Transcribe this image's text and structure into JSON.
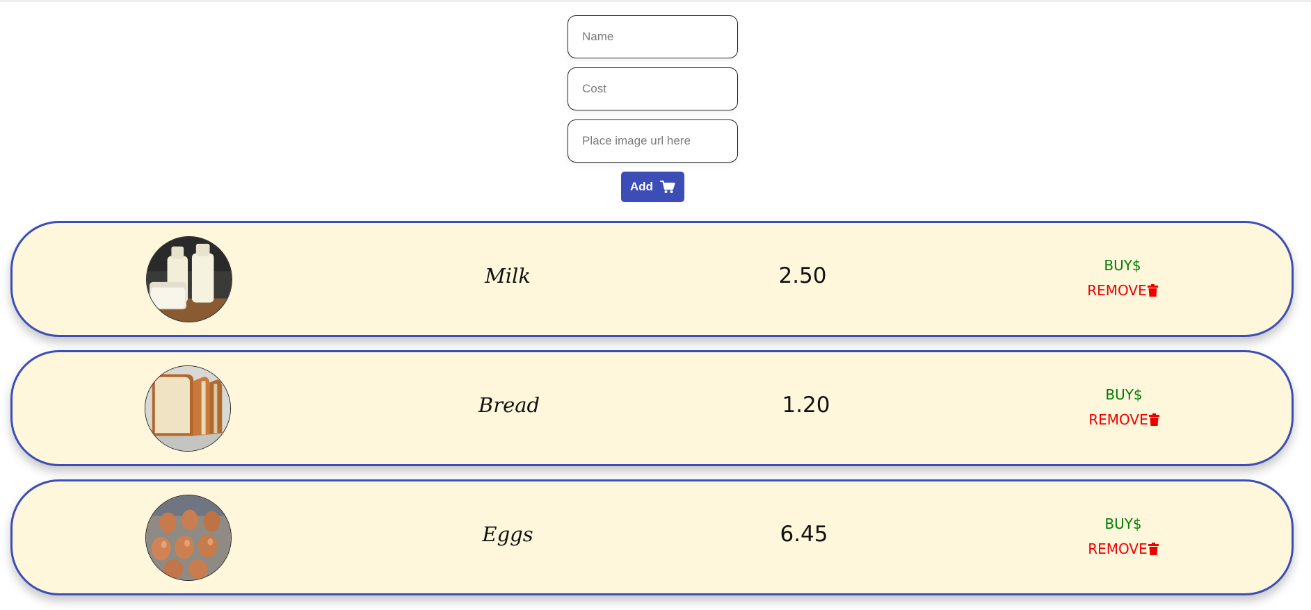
{
  "form": {
    "name_placeholder": "Name",
    "cost_placeholder": "Cost",
    "image_placeholder": "Place image url here",
    "add_label": "Add",
    "add_icon": "shopping-cart-icon"
  },
  "colors": {
    "accent": "#3d4db7",
    "card_background": "#fff7dc",
    "buy": "#007d00",
    "remove": "#ee0000"
  },
  "items": [
    {
      "name": "Milk",
      "cost": "2.50",
      "buy_label": "BUY$",
      "remove_label": "REMOVE",
      "image": "milk-photo"
    },
    {
      "name": "Bread",
      "cost": "1.20",
      "buy_label": "BUY$",
      "remove_label": "REMOVE",
      "image": "bread-photo"
    },
    {
      "name": "Eggs",
      "cost": "6.45",
      "buy_label": "BUY$",
      "remove_label": "REMOVE",
      "image": "eggs-photo"
    }
  ]
}
